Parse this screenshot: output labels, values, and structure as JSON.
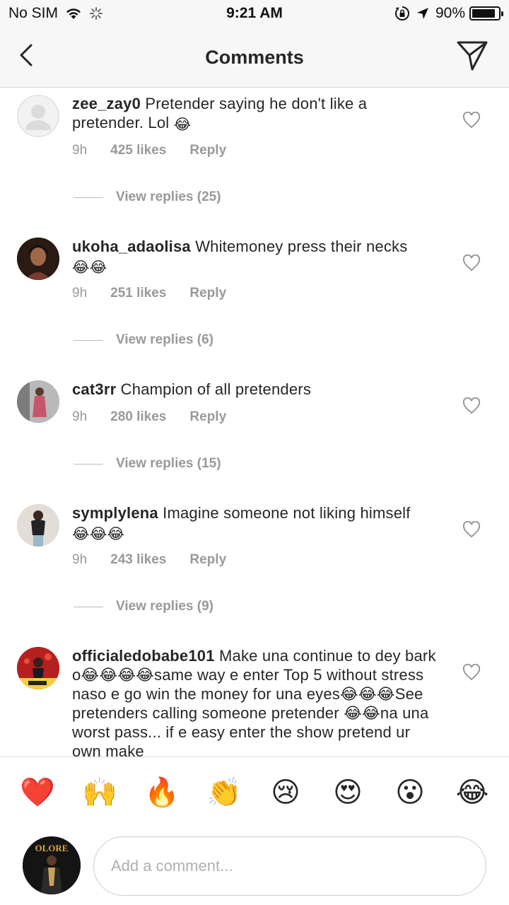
{
  "status_bar": {
    "carrier": "No SIM",
    "time": "9:21 AM",
    "battery": "90%",
    "battery_level": 0.9,
    "icons": [
      "wifi-icon",
      "loading-icon",
      "orientation-lock-icon",
      "location-arrow-icon",
      "battery-icon"
    ]
  },
  "nav": {
    "title": "Comments",
    "back_icon": "chevron-left-icon",
    "share_icon": "paper-plane-icon"
  },
  "comments": [
    {
      "username": "zee_zay0",
      "text": "Pretender saying he don't like a pretender. Lol",
      "emojis": "😂",
      "time": "9h",
      "likes": "425 likes",
      "reply": "Reply",
      "view_replies": "View replies (25)"
    },
    {
      "username": "ukoha_adaolisa",
      "text": "Whitemoney press their necks",
      "emojis": "😂😂",
      "time": "9h",
      "likes": "251 likes",
      "reply": "Reply",
      "view_replies": "View replies (6)"
    },
    {
      "username": "cat3rr",
      "text": "Champion of all pretenders",
      "emojis": "",
      "time": "9h",
      "likes": "280 likes",
      "reply": "Reply",
      "view_replies": "View replies (15)"
    },
    {
      "username": "symplylena",
      "text": "Imagine someone not liking himself",
      "emojis": "😂😂😂",
      "time": "9h",
      "likes": "243 likes",
      "reply": "Reply",
      "view_replies": "View replies (9)"
    },
    {
      "username": "officialedobabe101",
      "text": "Make una continue to dey bark o😂😂😂😂same way e enter Top 5 without stress naso e go win the money for una eyes😂😂😂See pretenders calling someone pretender 😂😂na una worst pass... if e easy enter the show pretend ur own make",
      "emojis": "",
      "time": "",
      "likes": "",
      "reply": "",
      "view_replies": ""
    }
  ],
  "reactions": [
    "❤️",
    "🙌",
    "🔥",
    "👏",
    "😢",
    "😍",
    "😮",
    "😂"
  ],
  "composer": {
    "placeholder": "Add a comment...",
    "avatar_text": "OLORE"
  }
}
